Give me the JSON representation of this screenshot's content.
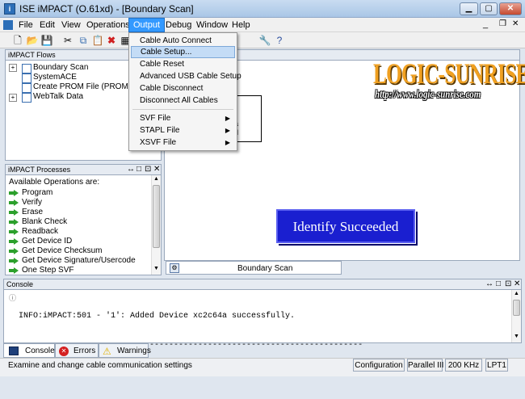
{
  "window": {
    "title": "ISE iMPACT (O.61xd) - [Boundary Scan]"
  },
  "menubar": [
    "File",
    "Edit",
    "View",
    "Operations",
    "Output",
    "Debug",
    "Window",
    "Help"
  ],
  "output_menu": {
    "group1": [
      "Cable Auto Connect",
      "Cable Setup...",
      "Cable Reset",
      "Advanced USB Cable Setup",
      "Cable Disconnect",
      "Disconnect All Cables"
    ],
    "group2": [
      "SVF File",
      "STAPL File",
      "XSVF File"
    ],
    "highlighted": "Cable Setup..."
  },
  "flows_panel": {
    "title": "iMPACT Flows",
    "items": [
      "Boundary Scan",
      "SystemACE",
      "Create PROM File (PROM File",
      "WebTalk Data"
    ]
  },
  "processes_panel": {
    "title": "iMPACT Processes",
    "heading": "Available Operations are:",
    "items": [
      "Program",
      "Verify",
      "Erase",
      "Blank Check",
      "Readback",
      "Get Device ID",
      "Get Device Checksum",
      "Get Device Signature/Usercode",
      "One Step SVF"
    ]
  },
  "canvas": {
    "logo_main": "LOGIC-SUNRISE",
    "logo_url": "http://www.logic-sunrise.com",
    "device_frag1": "a",
    "device_frag2": "d",
    "identify_text": "Identify Succeeded",
    "tab_label": "Boundary Scan"
  },
  "console": {
    "title": "Console",
    "lines": [
      "INFO:iMPACT:501 - '1': Added Device xc2c64a successfully.",
      "-----------------------------------------------------------------------",
      "-----------------------------------------------------------------------"
    ],
    "tabs": [
      "Console",
      "Errors",
      "Warnings"
    ]
  },
  "status": {
    "message": "Examine and change cable communication settings",
    "cells": [
      "Configuration",
      "Parallel III",
      "200 KHz",
      "LPT1"
    ]
  },
  "colors": {
    "accent": "#3399ff",
    "identify_bg": "#1a1fd0",
    "logo": "#f0a020"
  }
}
